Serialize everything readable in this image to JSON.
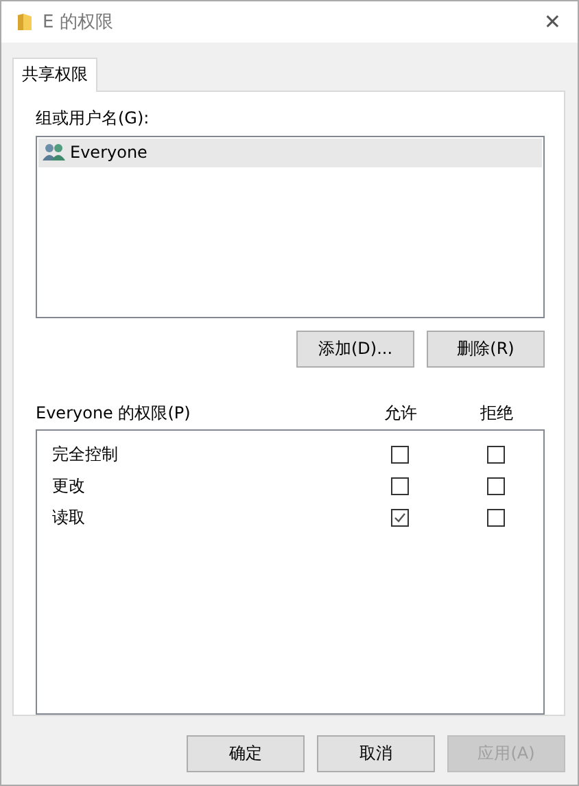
{
  "window": {
    "title": "E 的权限",
    "close": "✕"
  },
  "tabs": [
    {
      "label": "共享权限",
      "selected": true
    }
  ],
  "groups": {
    "label": "组或用户名(G):",
    "items": [
      {
        "name": "Everyone",
        "selected": true
      }
    ]
  },
  "group_buttons": [
    "添加(D)...",
    "删除(R)"
  ],
  "permissions": {
    "label": "Everyone 的权限(P)",
    "columns": [
      "允许",
      "拒绝"
    ],
    "rows": [
      {
        "name": "完全控制",
        "allow": false,
        "deny": false
      },
      {
        "name": "更改",
        "allow": false,
        "deny": false
      },
      {
        "name": "读取",
        "allow": true,
        "deny": false
      }
    ]
  },
  "buttons": [
    {
      "label": "确定",
      "disabled": false
    },
    {
      "label": "取消",
      "disabled": false
    },
    {
      "label": "应用(A)",
      "disabled": true
    }
  ]
}
